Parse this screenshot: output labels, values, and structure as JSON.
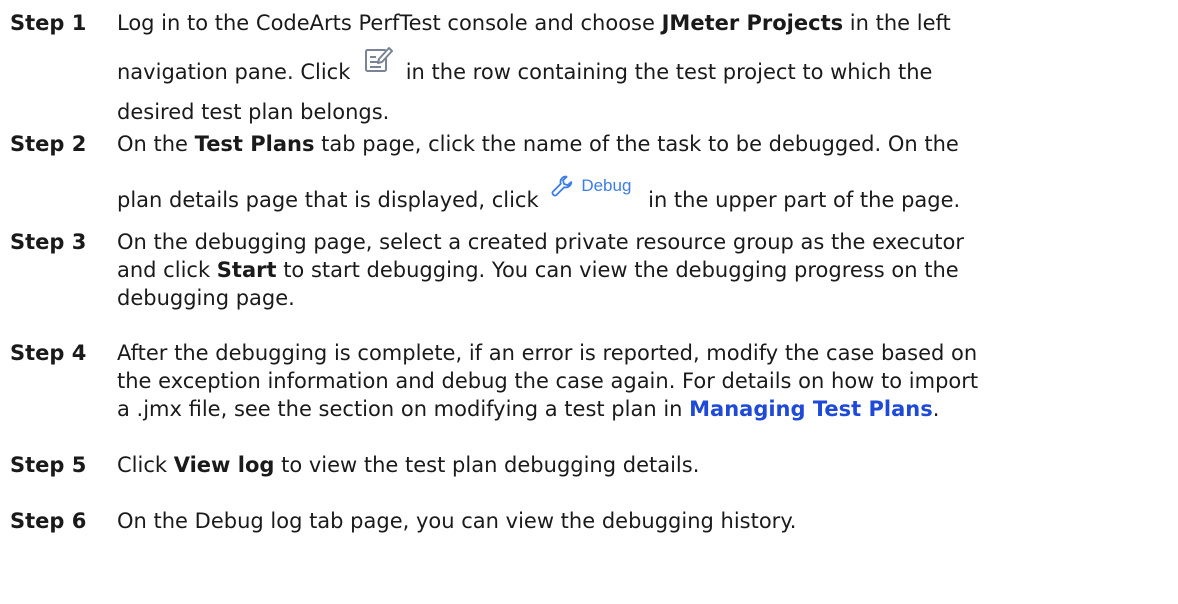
{
  "steps": [
    {
      "label": "Step 1",
      "line1": {
        "a": "Log in to the CodeArts PerfTest console and choose ",
        "b": "JMeter Projects",
        "c": " in the left"
      },
      "line2": {
        "a": "navigation pane. Click ",
        "icon": "edit-icon",
        "b": " in the row containing the test project to which the"
      },
      "line3": "desired test plan belongs."
    },
    {
      "label": "Step 2",
      "line1": {
        "a": "On the ",
        "b": "Test Plans",
        "c": " tab page, click the name of the task to be debugged. On the"
      },
      "line2": {
        "a": "plan details page that is displayed, click ",
        "button_label": "Debug",
        "icon": "wrench-icon",
        "b": " in the upper part of the page."
      }
    },
    {
      "label": "Step 3",
      "line1": "On the debugging page, select a created private resource group as the executor",
      "line2": {
        "a": "and click ",
        "b": "Start",
        "c": " to start debugging. You can view the debugging progress on the"
      },
      "line3": "debugging page."
    },
    {
      "label": "Step 4",
      "line1": "After the debugging is complete, if an error is reported, modify the case based on",
      "line2": "the exception information and debug the case again. For details on how to import",
      "line3": {
        "a": "a .jmx file, see the section on modifying a test plan in ",
        "link": "Managing Test Plans",
        "c": "."
      }
    },
    {
      "label": "Step 5",
      "line1": {
        "a": "Click ",
        "b": "View log",
        "c": " to view the test plan debugging details."
      }
    },
    {
      "label": "Step 6",
      "line1": "On the Debug log tab page, you can view the debugging history."
    }
  ],
  "colors": {
    "text": "#1a1a1a",
    "link": "#1f4ad8",
    "debug_button": "#3d7de6",
    "icon_gray": "#7a8494"
  }
}
